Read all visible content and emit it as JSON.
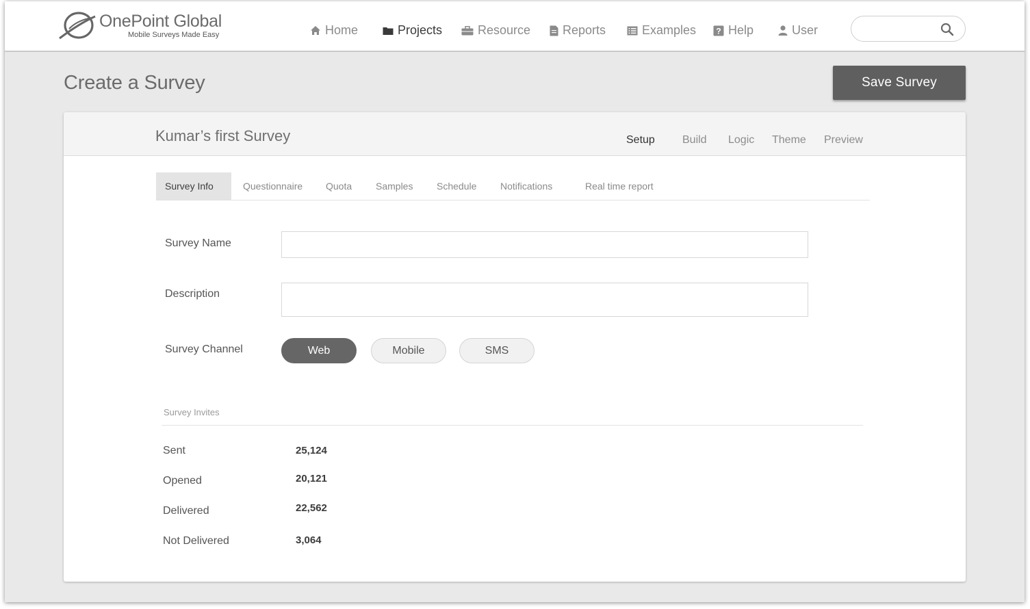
{
  "brand": {
    "name": "OnePoint Global",
    "tagline": "Mobile Surveys Made Easy"
  },
  "nav": [
    {
      "label": "Home",
      "icon": "home-icon"
    },
    {
      "label": "Projects",
      "icon": "folder-icon",
      "active": true
    },
    {
      "label": "Resource",
      "icon": "briefcase-icon"
    },
    {
      "label": "Reports",
      "icon": "document-icon"
    },
    {
      "label": "Examples",
      "icon": "list-icon"
    },
    {
      "label": "Help",
      "icon": "help-icon"
    },
    {
      "label": "User",
      "icon": "user-icon"
    }
  ],
  "search": {
    "placeholder": "",
    "icon": "search-icon"
  },
  "page": {
    "title": "Create a Survey",
    "save_label": "Save Survey"
  },
  "survey": {
    "title": "Kumar’s first Survey",
    "stages": [
      "Setup",
      "Build",
      "Logic",
      "Theme",
      "Preview"
    ],
    "active_stage": "Setup"
  },
  "subtabs": [
    "Survey Info",
    "Questionnaire",
    "Quota",
    "Samples",
    "Schedule",
    "Notifications",
    "Real time report"
  ],
  "active_subtab": "Survey Info",
  "form": {
    "name_label": "Survey Name",
    "name_value": "",
    "description_label": "Description",
    "description_value": "",
    "channel_label": "Survey Channel",
    "channels": [
      "Web",
      "Mobile",
      "SMS"
    ],
    "selected_channel": "Web"
  },
  "invites": {
    "title": "Survey Invites",
    "stats": [
      {
        "label": "Sent",
        "value": "25,124"
      },
      {
        "label": "Opened",
        "value": "20,121"
      },
      {
        "label": "Delivered",
        "value": "22,562"
      },
      {
        "label": "Not Delivered",
        "value": "3,064"
      }
    ]
  },
  "colors": {
    "accent": "#5f5f5f",
    "background": "#e9e9e9",
    "card": "#ffffff"
  }
}
